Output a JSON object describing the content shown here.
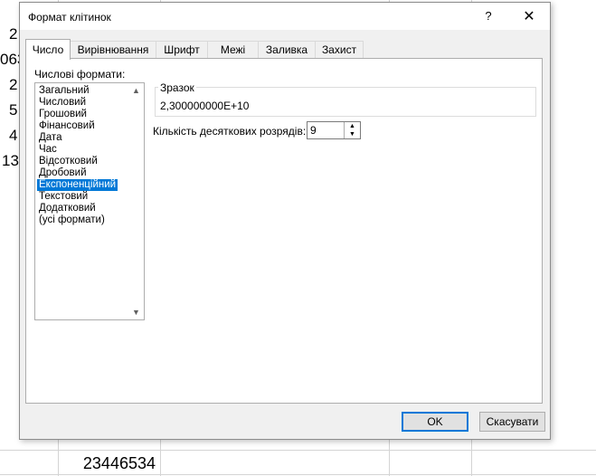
{
  "sheet": {
    "fragments": [
      "2",
      "063",
      "2",
      "5",
      "4",
      "13"
    ],
    "bottom_cell": "23446534"
  },
  "dialog": {
    "title": "Формат клітинок",
    "help": "?",
    "close": "✕",
    "tabs": [
      {
        "label": "Число",
        "active": true
      },
      {
        "label": "Вирівнювання"
      },
      {
        "label": "Шрифт"
      },
      {
        "label": "Межі"
      },
      {
        "label": "Заливка"
      },
      {
        "label": "Захист"
      }
    ],
    "category_label": "Числові формати:",
    "categories": [
      "Загальний",
      "Числовий",
      "Грошовий",
      "Фінансовий",
      "Дата",
      "Час",
      "Відсотковий",
      "Дробовий",
      "Експоненційний",
      "Текстовий",
      "Додатковий",
      "(усі формати)"
    ],
    "selected_category": "Експоненційний",
    "sample_label": "Зразок",
    "sample_value": "2,300000000E+10",
    "decimals_label": "Кількість десяткових розрядів:",
    "decimals_value": "9",
    "ok": "OK",
    "cancel": "Скасувати"
  }
}
